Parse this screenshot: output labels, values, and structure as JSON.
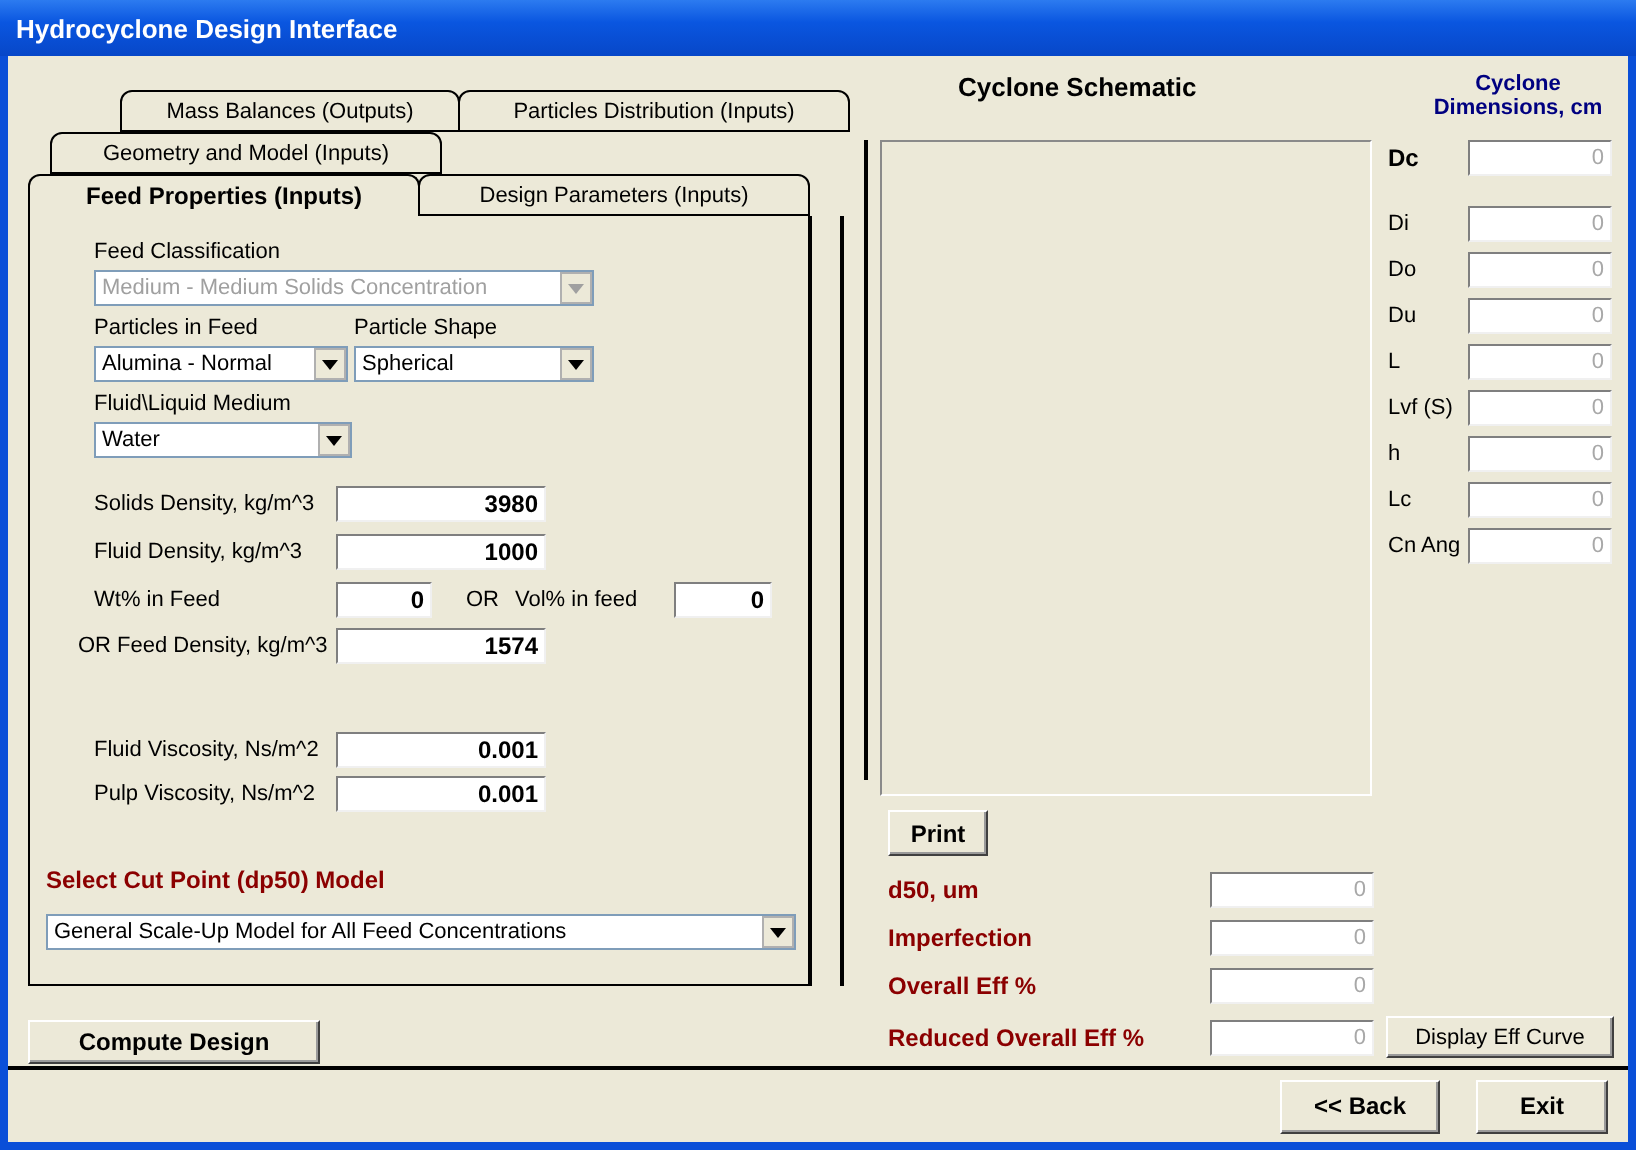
{
  "window": {
    "title": "Hydrocyclone Design Interface"
  },
  "tab_rows": [
    {
      "tabs": [
        {
          "label": "Mass Balances (Outputs)",
          "selected": false
        },
        {
          "label": "Particles Distribution (Inputs)",
          "selected": false
        }
      ]
    },
    {
      "tabs": [
        {
          "label": "Geometry and Model (Inputs)",
          "selected": false
        }
      ]
    },
    {
      "tabs": [
        {
          "label": "Feed Properties (Inputs)",
          "selected": true
        },
        {
          "label": "Design Parameters (Inputs)",
          "selected": false
        }
      ]
    }
  ],
  "feed_classification": {
    "label": "Feed Classification",
    "value": "Medium - Medium Solids Concentration",
    "disabled": true
  },
  "particles_in_feed": {
    "label": "Particles in Feed",
    "value": "Alumina - Normal",
    "disabled": false
  },
  "particle_shape": {
    "label": "Particle Shape",
    "value": "Spherical",
    "disabled": false
  },
  "fluid_medium": {
    "label": "Fluid\\Liquid Medium",
    "value": "Water",
    "disabled": false
  },
  "densities": [
    {
      "label": "Solids Density, kg/m^3",
      "value": "3980"
    },
    {
      "label": "Fluid Density, kg/m^3",
      "value": "1000"
    }
  ],
  "concentration": {
    "wt_label": "Wt% in Feed",
    "wt_value": "0",
    "or_label": "OR",
    "vol_label": "Vol% in feed",
    "vol_value": "0"
  },
  "feed_density": {
    "label": "OR Feed Density, kg/m^3",
    "value": "1574"
  },
  "viscosities": [
    {
      "label": "Fluid Viscosity, Ns/m^2",
      "value": "0.001"
    },
    {
      "label": "Pulp Viscosity, Ns/m^2",
      "value": "0.001"
    }
  ],
  "cut_point_model": {
    "heading": "Select Cut Point (dp50) Model",
    "value": "General Scale-Up Model for All Feed Concentrations"
  },
  "compute_button": {
    "label": "Compute Design"
  },
  "schematic": {
    "title": "Cyclone Schematic"
  },
  "dimensions": {
    "title": "Cyclone Dimensions, cm",
    "rows": [
      {
        "label": "Dc",
        "value": "0",
        "emphasized": true
      },
      {
        "label": "Di",
        "value": "0",
        "emphasized": false
      },
      {
        "label": "Do",
        "value": "0",
        "emphasized": false
      },
      {
        "label": "Du",
        "value": "0",
        "emphasized": false
      },
      {
        "label": "L",
        "value": "0",
        "emphasized": false
      },
      {
        "label": "Lvf (S)",
        "value": "0",
        "emphasized": false
      },
      {
        "label": "h",
        "value": "0",
        "emphasized": false
      },
      {
        "label": "Lc",
        "value": "0",
        "emphasized": false
      },
      {
        "label": "Cn Ang",
        "value": "0",
        "emphasized": false
      }
    ]
  },
  "print_button": "Print",
  "results": [
    {
      "label": "d50, um",
      "value": "0"
    },
    {
      "label": "Imperfection",
      "value": "0"
    },
    {
      "label": "Overall Eff %",
      "value": "0"
    },
    {
      "label": "Reduced Overall Eff %",
      "value": "0"
    }
  ],
  "display_button": "Display Eff Curve",
  "back_button": {
    "label": "<< Back"
  },
  "exit_button": {
    "label": "Exit"
  }
}
